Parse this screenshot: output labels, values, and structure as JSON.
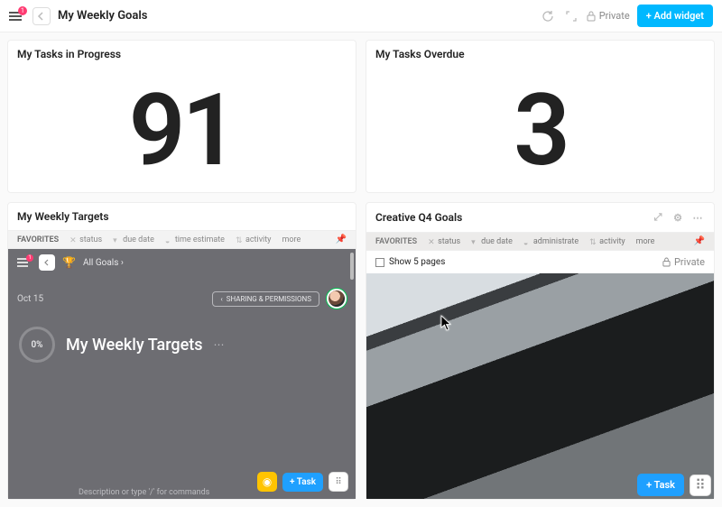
{
  "header": {
    "menu_badge": "1",
    "title": "My Weekly Goals",
    "privacy_label": "Private",
    "add_widget_label": "+ Add widget"
  },
  "widgets": {
    "tasks_in_progress": {
      "title": "My Tasks in Progress",
      "value": "91"
    },
    "tasks_overdue": {
      "title": "My Tasks Overdue",
      "value": "3"
    },
    "weekly_targets": {
      "title": "My Weekly Targets",
      "fav_label": "FAVORITES",
      "favorites": [
        "status",
        "due date",
        "time estimate",
        "activity",
        "more"
      ],
      "embed": {
        "menu_badge": "1",
        "all_goals": "All Goals",
        "date": "Oct 15",
        "share_label": "SHARING & PERMISSIONS",
        "progress": "0%",
        "goal_title": "My Weekly Targets",
        "add_task_label": "+ Task",
        "description_hint": "Description or type '/' for commands"
      }
    },
    "creative_q4": {
      "title": "Creative Q4 Goals",
      "fav_label": "FAVORITES",
      "favorites": [
        "status",
        "due date",
        "administrate",
        "activity",
        "more"
      ],
      "show_pages": "Show 5 pages",
      "privacy": "Private"
    }
  },
  "global": {
    "fab_task": "+ Task"
  }
}
